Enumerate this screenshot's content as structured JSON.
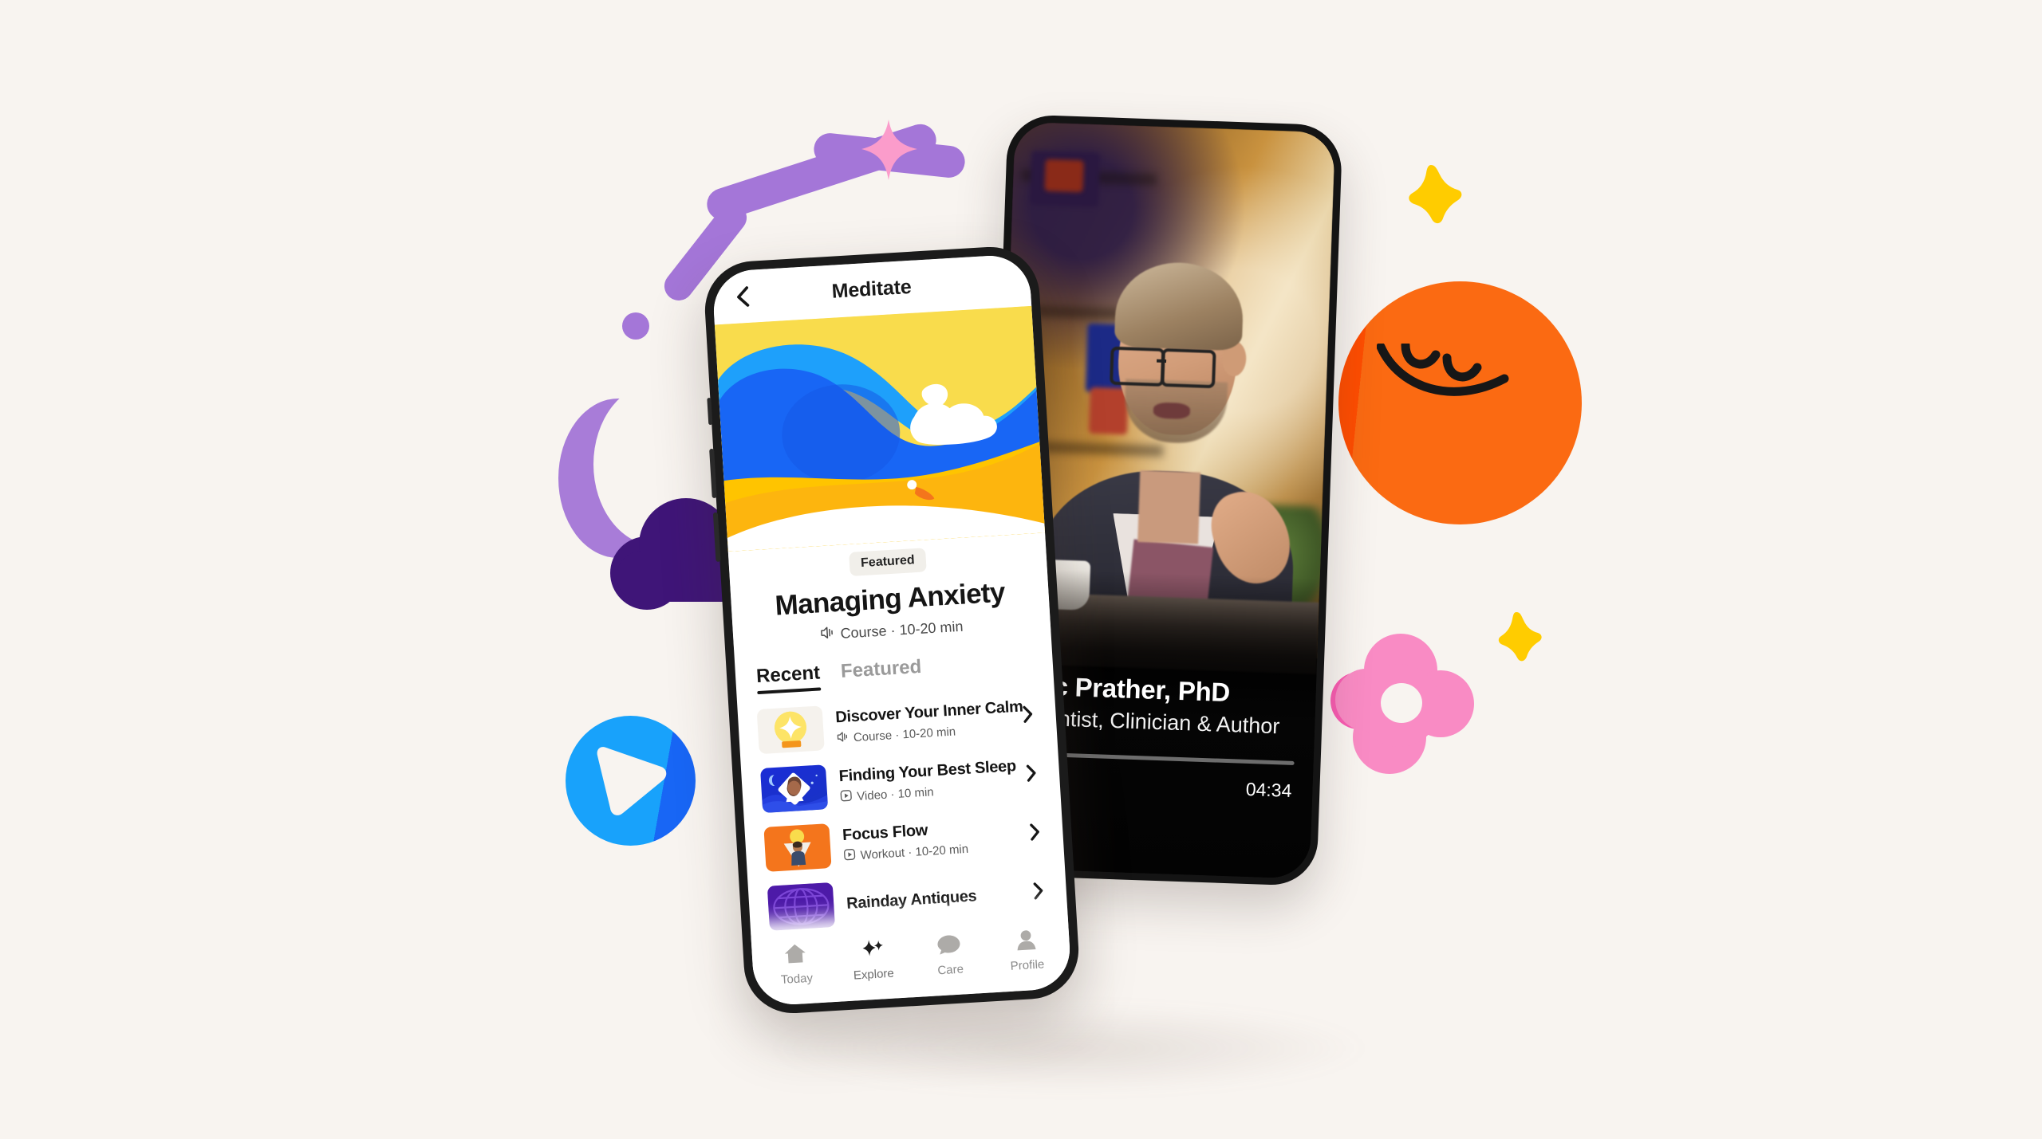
{
  "background_color": "#F8F4F0",
  "app_phone": {
    "app_bar": {
      "back_icon": "chevron-left-icon",
      "title": "Meditate"
    },
    "featured": {
      "badge": "Featured",
      "title": "Managing Anxiety",
      "meta_icon": "audio-waves-icon",
      "meta": "Course · 10-20 min"
    },
    "tabs": [
      {
        "label": "Recent",
        "active": true
      },
      {
        "label": "Featured",
        "active": false
      }
    ],
    "list_items": [
      {
        "title": "Discover Your Inner Calm",
        "meta_icon": "audio-waves-icon",
        "meta": "Course · 10-20 min",
        "thumb": "crystal-ball-yellow",
        "chevron": "chevron-right-icon"
      },
      {
        "title": "Finding Your Best Sleep",
        "meta_icon": "video-play-icon",
        "meta": "Video · 10 min",
        "thumb": "night-moon-blue",
        "chevron": "chevron-right-icon"
      },
      {
        "title": "Focus Flow",
        "meta_icon": "video-play-icon",
        "meta": "Workout · 10-20 min",
        "thumb": "focus-orange",
        "chevron": "chevron-right-icon"
      },
      {
        "title": "Rainday Antiques",
        "meta_icon": "",
        "meta": "",
        "thumb": "rain-purple",
        "chevron": "chevron-right-icon"
      }
    ],
    "tab_bar": [
      {
        "label": "Today",
        "icon": "home-icon"
      },
      {
        "label": "Explore",
        "icon": "sparkle-diamond-icon"
      },
      {
        "label": "Care",
        "icon": "chat-bubble-icon"
      },
      {
        "label": "Profile",
        "icon": "person-icon"
      }
    ]
  },
  "video_phone": {
    "speaker_name": "Aric Prather, PhD",
    "speaker_role": "Scientist, Clinician & Author",
    "timestamp": "04:34",
    "progress_percent": 13
  },
  "decorations": [
    {
      "name": "purple-arc",
      "color": "#A476D8"
    },
    {
      "name": "pink-sparkle",
      "color": "#FB9CCB"
    },
    {
      "name": "purple-moon",
      "color": "#A87CD8"
    },
    {
      "name": "purple-cloud",
      "color": "#3F1578"
    },
    {
      "name": "blue-play-circle",
      "color": "#18A2FB"
    },
    {
      "name": "orange-smiley-blob",
      "color": "#FB6A12"
    },
    {
      "name": "yellow-star-top",
      "color": "#FFCC00"
    },
    {
      "name": "yellow-star-bottom",
      "color": "#FFCC00"
    },
    {
      "name": "pink-flower",
      "color": "#F98BC4"
    }
  ]
}
